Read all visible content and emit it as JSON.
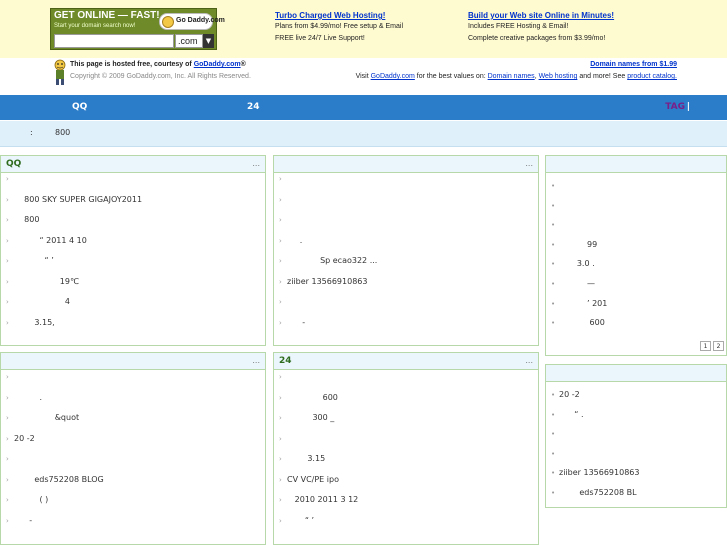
{
  "promo": {
    "box_title": "GET ONLINE — FAST!",
    "box_subtitle": "Start your domain search now!",
    "logo_text": "Go Daddy.com",
    "search_value": "",
    "tld_value": ".com",
    "col1": {
      "link": "Turbo Charged Web Hosting!",
      "line1": "Plans from $4.99/mo! Free setup & Email",
      "line2": "FREE live 24/7 Live Support!"
    },
    "col2": {
      "link": "Build your Web site Online in Minutes!",
      "line1": "Includes FREE Hosting & Email!",
      "line2": "Complete creative packages from $3.99/mo!"
    }
  },
  "hosted": {
    "line1_prefix": "This page is hosted free, courtesy of ",
    "line1_link": "GoDaddy.com",
    "line1_suffix": "®",
    "copyright": "Copyright © 2009 GoDaddy.com, Inc. All Rights Reserved.",
    "right_link": "Domain names from $1.99",
    "right_prefix": "Visit ",
    "right_site": "GoDaddy.com",
    "right_mid": " for the best values on: ",
    "right_domain": "Domain names",
    "right_comma": ", ",
    "right_hosting": "Web hosting",
    "right_after": " and more! See ",
    "right_catalog": "product catalog."
  },
  "nav": {
    "qq": "QQ",
    "n24": "24",
    "tag": "TAG",
    "sep": "|"
  },
  "info": {
    "colon": ":",
    "count": "800"
  },
  "panels": {
    "p1": {
      "title": "QQ",
      "more": "...",
      "items": [
        "",
        "800   SKY   SUPER GIGAJOY2011",
        "800",
        "“   2011 4 10",
        "“   ’",
        "19℃",
        "4",
        "3.15,"
      ]
    },
    "p2": {
      "title": "",
      "more": "...",
      "items": [
        "",
        "",
        "",
        ".",
        "Sp ecao322       ...",
        "ziiber     13566910863",
        "",
        "-"
      ]
    },
    "p3": {
      "title": "",
      "more": "",
      "items": [
        "",
        "",
        "",
        "99",
        "3.0       .",
        "—",
        "’   201",
        "600"
      ],
      "pages": [
        "1",
        "2"
      ]
    },
    "p4": {
      "title": "",
      "more": "...",
      "items": [
        "",
        ".",
        "&quot",
        "20       -2",
        "",
        "eds752208    BLOG",
        "(       )",
        "-"
      ]
    },
    "p5": {
      "title": "24",
      "more": "...",
      "items": [
        "",
        "600",
        "300    _",
        "",
        "3.15",
        "CV      VC/PE          ipo",
        "2010           2011 3 12",
        "“   ’"
      ]
    },
    "p6": {
      "title": "",
      "more": "",
      "items": [
        "20       -2",
        "“   .",
        "",
        "",
        "ziiber     13566910863",
        "eds752208    BL"
      ]
    }
  }
}
